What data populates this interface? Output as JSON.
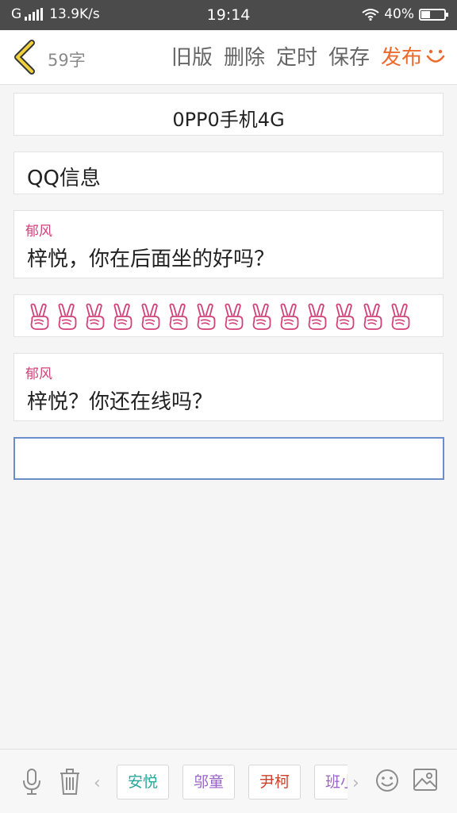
{
  "status_bar": {
    "network": "G",
    "speed": "13.9K/s",
    "time": "19:14",
    "battery_text": "40%",
    "battery_level": 0.4,
    "icons": [
      "signal-icon",
      "wifi-icon",
      "battery-icon"
    ]
  },
  "toolbar": {
    "char_count": "59字",
    "actions": [
      "旧版",
      "删除",
      "定时",
      "保存"
    ],
    "publish": "发布",
    "publish_color": "#ec6a2c",
    "icons": [
      "back-arrow-icon",
      "smile-icon"
    ]
  },
  "editor": {
    "title_line": "0PP0手机4G",
    "header_line": "QQ信息",
    "message_1": {
      "speaker": "郁风",
      "text": "梓悦，你在后面坐的好吗？"
    },
    "emoji_row": {
      "icon": "peace-hand-icon",
      "count": 14,
      "color": "#d1427a"
    },
    "message_2": {
      "speaker": "郁风",
      "text": "梓悦？你还在线吗？"
    },
    "active_block": ""
  },
  "bottom_bar": {
    "chips": [
      {
        "label": "安悦",
        "color": "#2aa79b"
      },
      {
        "label": "邬童",
        "color": "#9a63c9"
      },
      {
        "label": "尹柯",
        "color": "#d0402b"
      },
      {
        "label": "班小",
        "color": "#9a63c9"
      }
    ],
    "icons": [
      "microphone-icon",
      "trash-icon",
      "chevron-left-icon",
      "chevron-right-icon",
      "emoji-icon",
      "image-icon"
    ]
  }
}
